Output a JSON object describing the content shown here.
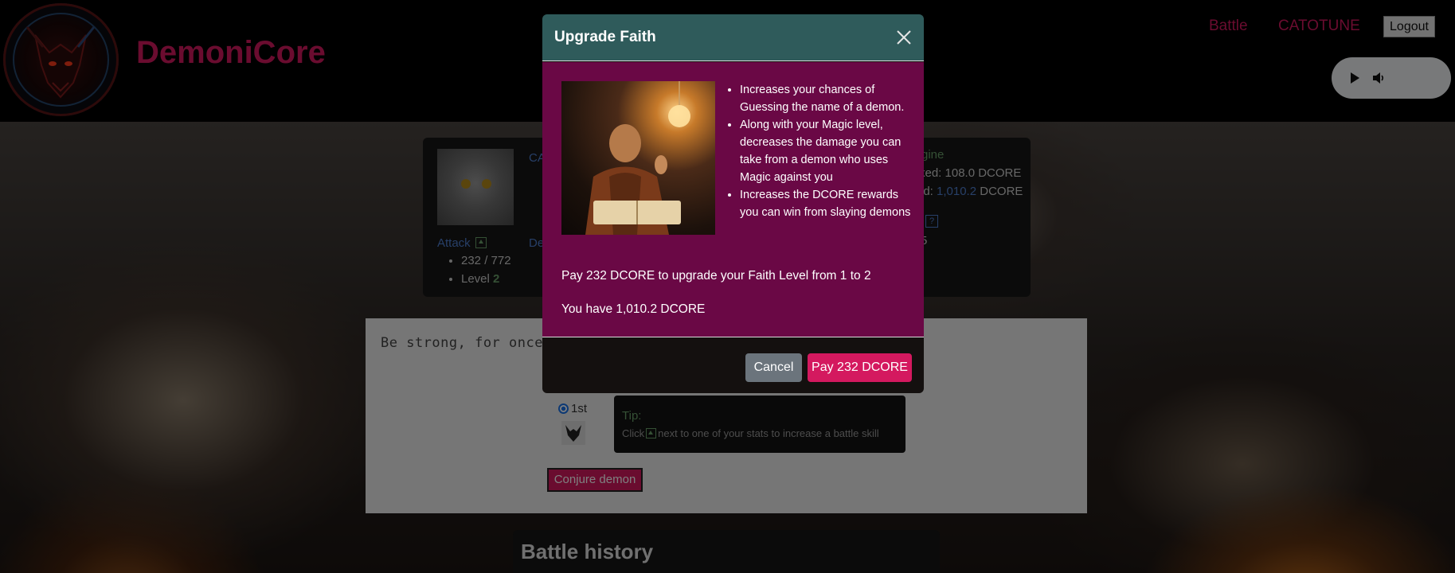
{
  "header": {
    "brand": "DemoniCore",
    "nav": [
      {
        "label": "Battle"
      },
      {
        "label": "CATOTUNE"
      }
    ],
    "logout_label": "Logout"
  },
  "player_card": {
    "name_partial": "CA",
    "attack_label": "Attack",
    "attack_points": "232 / 772",
    "attack_level_label": "Level",
    "attack_level": "2",
    "defense_partial": "De",
    "engine_partial": "gine",
    "locked_partial": "ked: 108.0 DCORE",
    "paid_partial_prefix": "id:",
    "paid_value": "1,010.2",
    "paid_suffix": "DCORE",
    "faith_partial": "5"
  },
  "game": {
    "quote_partial": "Be strong, for once you be",
    "radio_label": "1st",
    "tip_title": "Tip:",
    "tip_before": "Click",
    "tip_after": "next to one of your stats to increase a battle skill",
    "conjure_label": "Conjure demon"
  },
  "history": {
    "title": "Battle history"
  },
  "modal": {
    "title": "Upgrade Faith",
    "benefits": [
      "Increases your chances of Guessing the name of a demon.",
      "Along with your Magic level, decreases the damage you can take from a demon who uses Magic against you",
      "Increases the DCORE rewards you can win from slaying demons"
    ],
    "pay_text": "Pay 232 DCORE to upgrade your Faith Level from 1 to 2",
    "have_text": "You have 1,010.2 DCORE",
    "cancel_label": "Cancel",
    "pay_label": "Pay 232 DCORE"
  },
  "colors": {
    "brand": "#d4195f",
    "modal_header": "#2f5b5b",
    "modal_body": "#6a0845",
    "cancel": "#6b747c"
  },
  "icons": [
    "demon-logo-icon",
    "play-icon",
    "volume-icon",
    "close-icon",
    "stat-upgrade-icon",
    "help-icon",
    "demon-mini-icon"
  ]
}
